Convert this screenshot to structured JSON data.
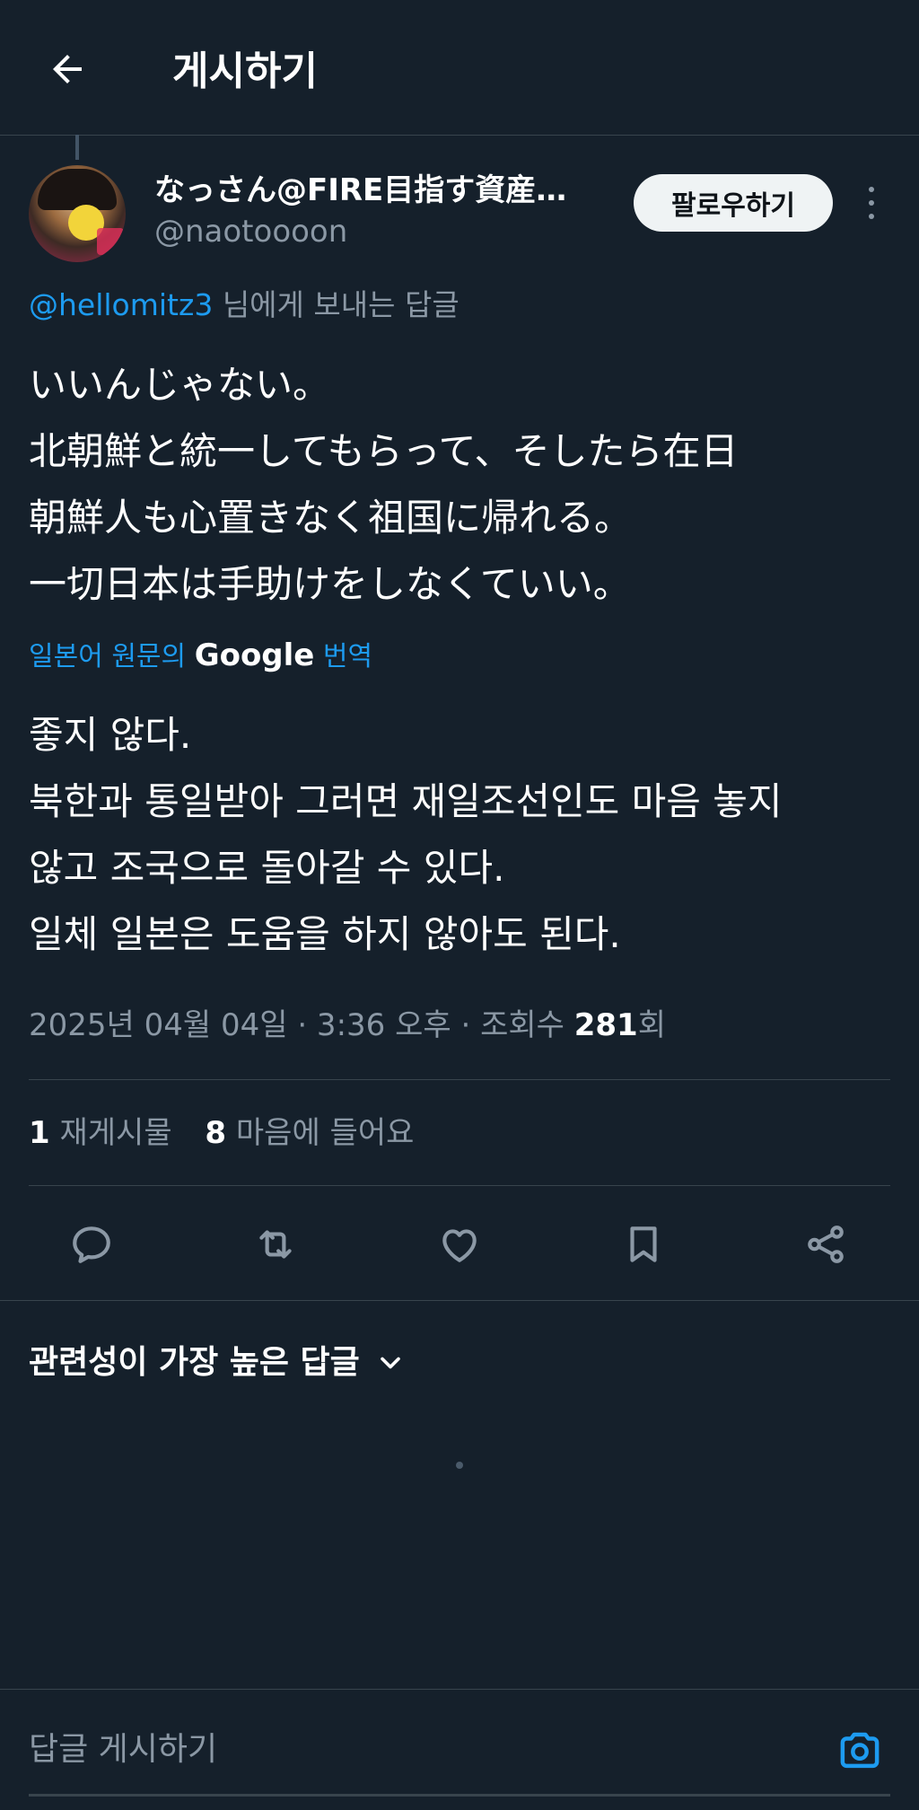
{
  "header": {
    "back_label": "back",
    "title": "게시하기"
  },
  "tweet": {
    "author_name": "なっさん@FIRE目指す資産…",
    "author_handle": "@naotoooon",
    "follow_label": "팔로우하기",
    "reply_to": {
      "mention": "@hellomitz3",
      "suffix": " 님에게 보내는 답글"
    },
    "text_lines": [
      "いいんじゃない。",
      "北朝鮮と統一してもらって、そしたら在日",
      "朝鮮人も心置きなく祖国に帰れる。",
      "一切日本は手助けをしなくていい。"
    ],
    "translation_label": {
      "prefix": "일본어 원문의 ",
      "google": "Google",
      "suffix": " 번역"
    },
    "translated_lines": [
      "좋지 않다.",
      "북한과 통일받아 그러면 재일조선인도 마음 놓지",
      "않고 조국으로 돌아갈 수 있다.",
      "일체 일본은 도움을 하지 않아도 된다."
    ],
    "meta": {
      "datetime": "2025년 04월 04일 · 3:36 오후 · 조회수 ",
      "views": "281",
      "views_suffix": "회"
    },
    "stats": {
      "retweets_count": "1",
      "retweets_label": " 재게시물",
      "likes_count": "8",
      "likes_label": " 마음에 들어요"
    }
  },
  "replies": {
    "sort_label": "관련성이 가장 높은 답글"
  },
  "composer": {
    "placeholder": "답글 게시하기"
  },
  "icons": {
    "back": "arrow-left-icon",
    "more": "more-vertical-icon",
    "reply": "reply-icon",
    "retweet": "retweet-icon",
    "like": "heart-icon",
    "bookmark": "bookmark-icon",
    "share": "share-icon",
    "sort": "chevron-down-icon",
    "camera": "camera-icon"
  },
  "colors": {
    "background": "#15202b",
    "accent": "#1d9bf0",
    "secondary_text": "#8b98a5",
    "border": "#38444d"
  }
}
